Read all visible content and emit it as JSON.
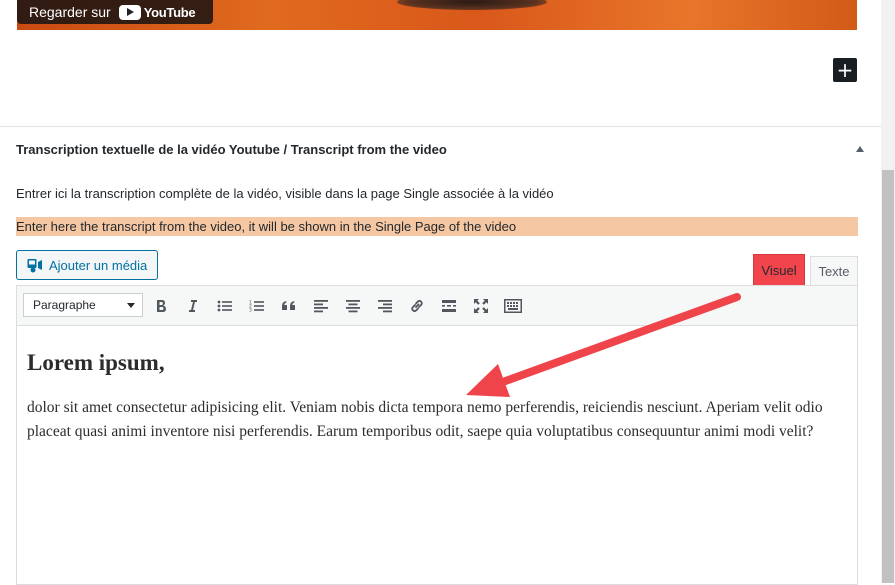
{
  "video": {
    "watch_on_label": "Regarder sur",
    "brand": "YouTube"
  },
  "metabox": {
    "title": "Transcription textuelle de la vidéo Youtube / Transcript from the video",
    "description": "Entrer ici la transcription complète de la vidéo, visible dans la page Single associée à la vidéo",
    "hint": "Enter here the transcript from the video, it will be shown in the Single Page of the video"
  },
  "editor": {
    "add_media_label": "Ajouter un média",
    "tabs": {
      "visual": "Visuel",
      "text": "Texte"
    },
    "format_select": "Paragraphe",
    "toolbar_icons": [
      "bold-icon",
      "italic-icon",
      "bullet-list-icon",
      "numbered-list-icon",
      "blockquote-icon",
      "align-left-icon",
      "align-center-icon",
      "align-right-icon",
      "link-icon",
      "read-more-icon",
      "fullscreen-icon",
      "toolbar-toggle-icon"
    ],
    "heading": "Lorem ipsum,",
    "paragraph": "dolor sit amet consectetur adipisicing elit. Veniam nobis dicta tempora nemo perferendis, reiciendis nesciunt. Aperiam velit odio placeat quasi animi inventore nisi perferendis. Earum temporibus odit, saepe quia voluptatibus consequuntur animi modi velit?"
  },
  "colors": {
    "hint_bg": "#f5c8a3",
    "visual_tab_bg": "#f1444d",
    "arrow": "#f0444b",
    "link_blue": "#0071a1"
  }
}
